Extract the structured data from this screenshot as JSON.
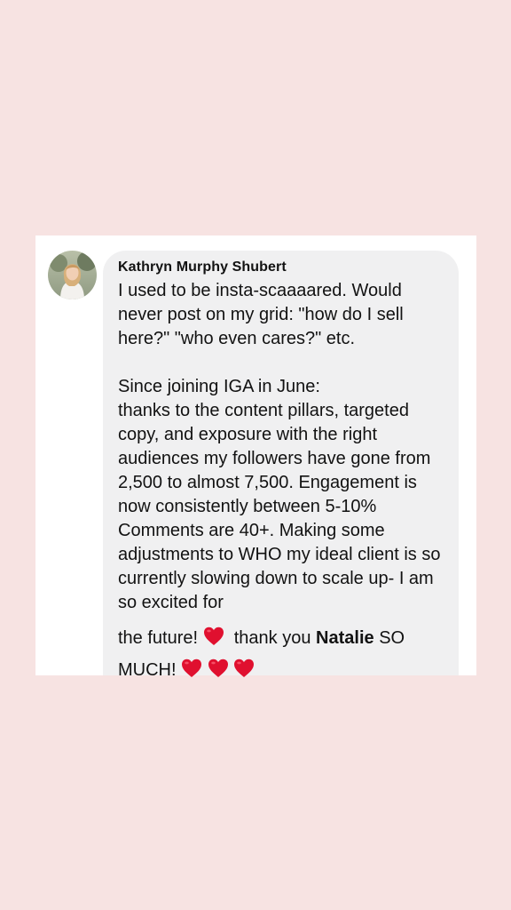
{
  "comment": {
    "author": "Kathryn Murphy Shubert",
    "paragraph1": "I used to be insta-scaaaared. Would never post on my grid: \"how do I sell here?\" \"who even cares?\" etc.",
    "paragraph2": "Since joining IGA in June:",
    "paragraph3": "thanks to the content pillars, targeted copy, and exposure with the right audiences my followers have gone from 2,500 to almost 7,500. Engagement is now consistently between 5-10% Comments are 40+. Making some adjustments to WHO my ideal client is so currently slowing down to scale up- I am so excited for",
    "line_start": "the future!",
    "thanks_text": "thank you",
    "mention": "Natalie",
    "so_text": "SO",
    "much_text": "MUCH!"
  },
  "colors": {
    "background": "#f7e3e2",
    "card": "#ffffff",
    "bubble": "#f0f0f1",
    "text": "#121212",
    "heart": "#e0102f"
  },
  "icons": {
    "heart": "red-heart-emoji",
    "avatar": "profile-photo"
  }
}
